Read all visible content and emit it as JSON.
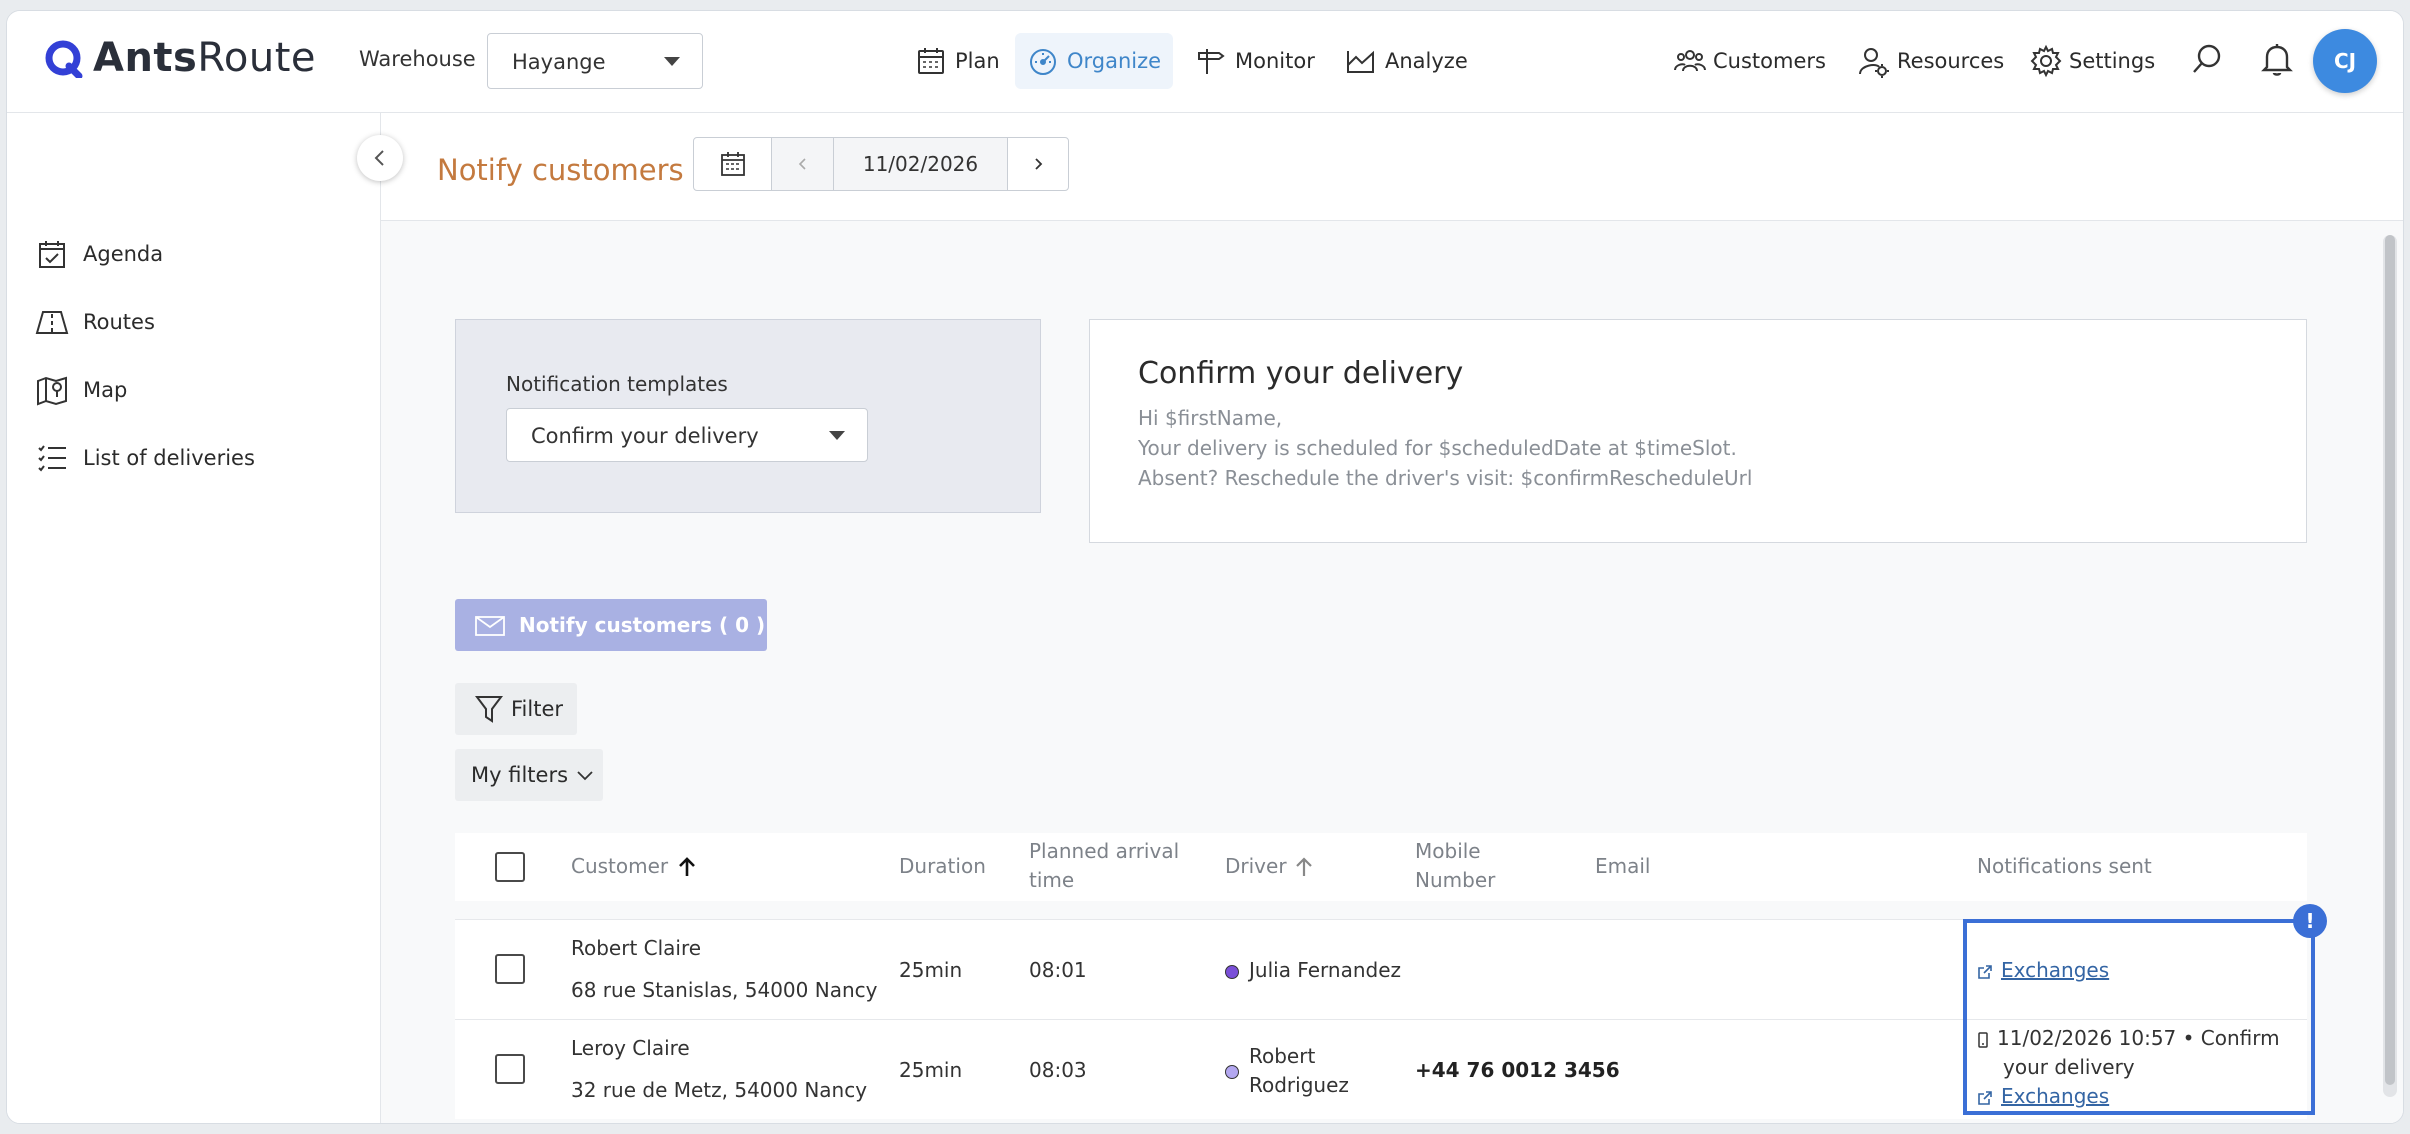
{
  "app": {
    "logo_text_bold": "Ants",
    "logo_text_regular": "Route"
  },
  "topbar": {
    "warehouse_label": "Warehouse",
    "warehouse_value": "Hayange",
    "nav": [
      {
        "label": "Plan",
        "icon": "calendar-icon"
      },
      {
        "label": "Organize",
        "icon": "speedometer-icon",
        "active": true
      },
      {
        "label": "Monitor",
        "icon": "signpost-icon"
      },
      {
        "label": "Analyze",
        "icon": "area-chart-icon"
      }
    ],
    "right": [
      {
        "label": "Customers",
        "icon": "customers-icon"
      },
      {
        "label": "Resources",
        "icon": "resources-icon"
      },
      {
        "label": "Settings",
        "icon": "gear-icon"
      }
    ],
    "avatar_initials": "CJ"
  },
  "sidebar": {
    "items": [
      {
        "label": "Agenda",
        "icon": "calendar-check-icon"
      },
      {
        "label": "Routes",
        "icon": "map-routes-icon"
      },
      {
        "label": "Map",
        "icon": "map-pin-icon"
      },
      {
        "label": "List of deliveries",
        "icon": "list-icon"
      }
    ]
  },
  "header": {
    "title": "Notify customers",
    "date": "11/02/2026"
  },
  "templates": {
    "label": "Notification templates",
    "selected": "Confirm your delivery"
  },
  "preview": {
    "title": "Confirm your delivery",
    "lines": [
      "Hi $firstName,",
      "Your delivery is scheduled for $scheduledDate at $timeSlot.",
      "Absent? Reschedule the driver's visit: $confirmRescheduleUrl"
    ]
  },
  "actions": {
    "notify_label": "Notify customers ( 0 )",
    "filter_label": "Filter",
    "my_filters_label": "My filters"
  },
  "table": {
    "columns": {
      "customer": "Customer",
      "duration": "Duration",
      "arrival_1": "Planned arrival",
      "arrival_2": "time",
      "driver": "Driver",
      "mobile_1": "Mobile",
      "mobile_2": "Number",
      "email": "Email",
      "notifications": "Notifications sent"
    },
    "rows": [
      {
        "name": "Robert Claire",
        "address": "68 rue Stanislas, 54000 Nancy",
        "duration": "25min",
        "arrival": "08:01",
        "driver": "Julia Fernandez",
        "driver_color": "#7a4fd8",
        "mobile": "",
        "email": "",
        "exchanges": "Exchanges"
      },
      {
        "name": "Leroy Claire",
        "address": "32 rue de Metz, 54000 Nancy",
        "duration": "25min",
        "arrival": "08:03",
        "driver_1": "Robert",
        "driver_2": "Rodriguez",
        "driver_color": "#b3a7f0",
        "mobile": "+44 76 0012 3456",
        "email": "",
        "notification_1": "11/02/2026 10:57 • Confirm",
        "notification_2": "your delivery",
        "exchanges": "Exchanges"
      }
    ]
  },
  "alert_badge": "!"
}
